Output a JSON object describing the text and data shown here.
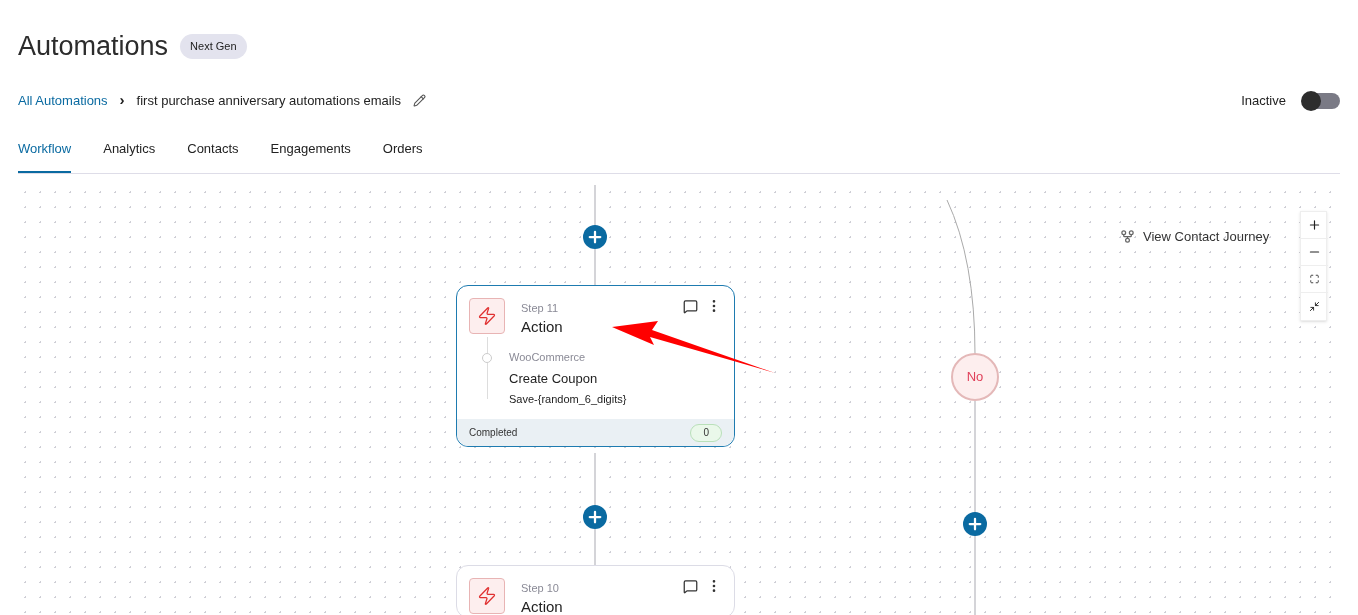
{
  "page": {
    "title": "Automations",
    "badge": "Next Gen"
  },
  "breadcrumb": {
    "parent": "All Automations",
    "separator": "›",
    "current": "first purchase anniversary automations emails"
  },
  "status_toggle": {
    "label": "Inactive",
    "on": false
  },
  "tabs": [
    {
      "label": "Workflow",
      "selected": true
    },
    {
      "label": "Analytics",
      "selected": false
    },
    {
      "label": "Contacts",
      "selected": false
    },
    {
      "label": "Engagements",
      "selected": false
    },
    {
      "label": "Orders",
      "selected": false
    }
  ],
  "canvas": {
    "journey_link": "View Contact Journey",
    "branch_label": "No",
    "steps": [
      {
        "step": "Step 11",
        "type": "Action",
        "app": "WooCommerce",
        "action": "Create Coupon",
        "detail": "Save-{random_6_digits}",
        "status": "Completed",
        "count": "0"
      },
      {
        "step": "Step 10",
        "type": "Action"
      }
    ]
  }
}
